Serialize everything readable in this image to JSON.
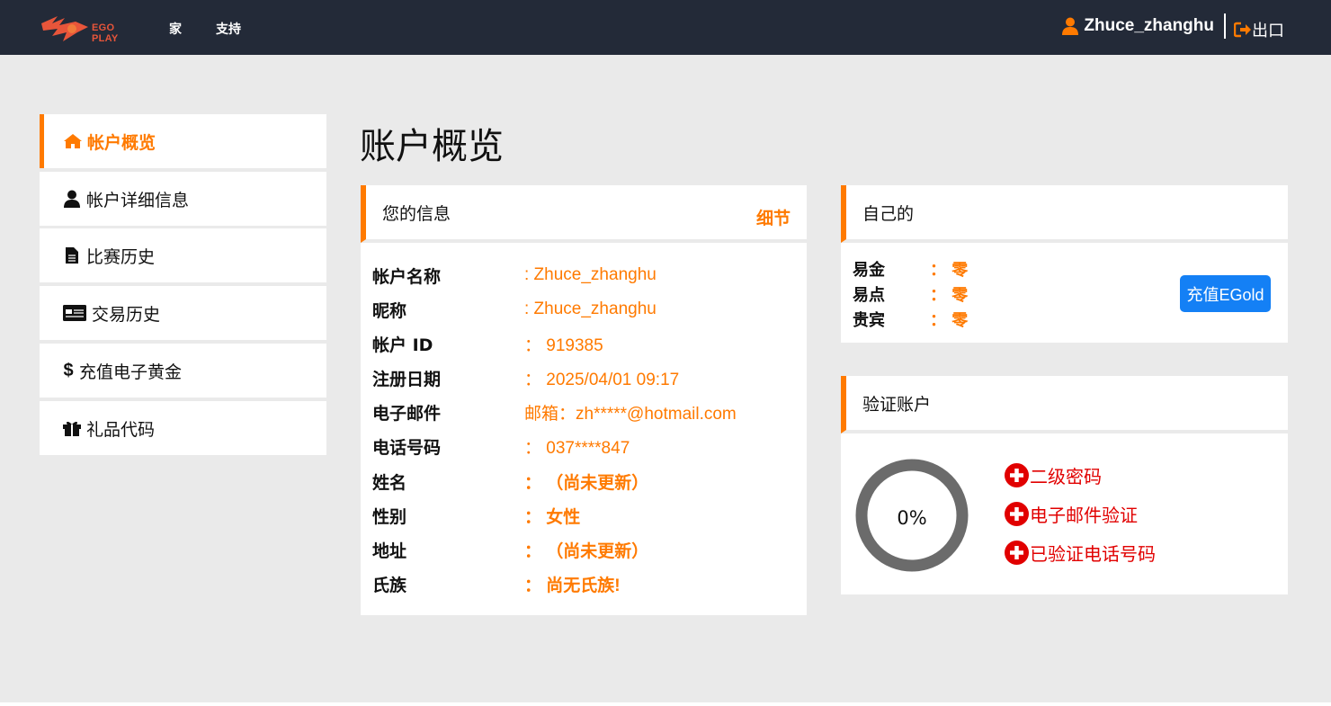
{
  "header": {
    "logo_text": "EGO PLAY",
    "nav": [
      {
        "label": "家"
      },
      {
        "label": "支持"
      }
    ],
    "user_name": "Zhuce_zhanghu",
    "logout_label": "出口"
  },
  "sidebar": {
    "items": [
      {
        "label": "帐户概览",
        "icon": "home-icon",
        "active": true
      },
      {
        "label": "帐户详细信息",
        "icon": "user-icon"
      },
      {
        "label": "比赛历史",
        "icon": "file-icon"
      },
      {
        "label": "交易历史",
        "icon": "card-icon"
      },
      {
        "label": "充值电子黄金",
        "icon": "dollar-icon"
      },
      {
        "label": "礼品代码",
        "icon": "gift-icon"
      }
    ]
  },
  "page": {
    "title": "账户概览"
  },
  "info_card": {
    "title": "您的信息",
    "detail_link": "细节",
    "rows": [
      {
        "label": "帐户名称",
        "value": ": Zhuce_zhanghu"
      },
      {
        "label": "昵称",
        "value": ": Zhuce_zhanghu"
      },
      {
        "label": "帐户 ID",
        "value": "： 919385"
      },
      {
        "label": "注册日期",
        "value": "： 2025/04/01 09:17"
      },
      {
        "label": "电子邮件",
        "value": "邮箱：zh*****@hotmail.com"
      },
      {
        "label": "电话号码",
        "value": "： 037****847"
      },
      {
        "label": "姓名",
        "value": "： （尚未更新）"
      },
      {
        "label": "性别",
        "value": "：  女性"
      },
      {
        "label": "地址",
        "value": "： （尚未更新）"
      },
      {
        "label": "氏族",
        "value": "： 尚无氏族!"
      }
    ]
  },
  "own_card": {
    "title": "自己的",
    "rows": [
      {
        "label": "易金",
        "value": "： 零"
      },
      {
        "label": "易点",
        "value": "： 零"
      },
      {
        "label": "贵宾",
        "value": "： 零"
      }
    ],
    "recharge_label": "充值EGold"
  },
  "verify_card": {
    "title": "验证账户",
    "progress_text": "0%",
    "progress": 0,
    "items": [
      {
        "label": "二级密码"
      },
      {
        "label": "电子邮件验证"
      },
      {
        "label": "已验证电话号码"
      }
    ]
  },
  "colors": {
    "accent": "#ff7a00",
    "topbar": "#232a38",
    "background": "#eaeaea",
    "button": "#1480f5",
    "danger": "#e10000",
    "ring": "#6b6b6b"
  }
}
